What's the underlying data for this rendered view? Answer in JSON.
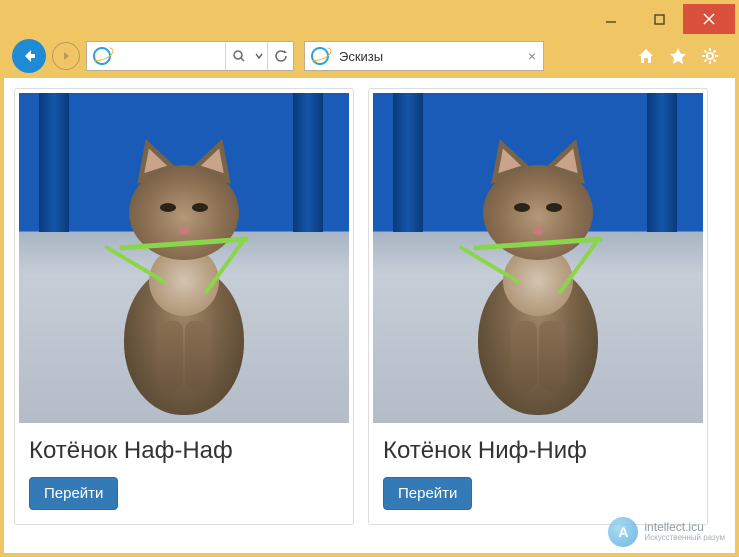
{
  "window": {
    "minimize": "–",
    "maximize": "□",
    "close": "×"
  },
  "toolbar": {
    "address": "",
    "tab_title": "Эскизы",
    "search_placeholder": ""
  },
  "cards": [
    {
      "title": "Котёнок Наф-Наф",
      "button": "Перейти"
    },
    {
      "title": "Котёнок Ниф-Ниф",
      "button": "Перейти"
    }
  ],
  "watermark": {
    "letter": "A",
    "brand": "intellect.icu",
    "subtitle": "Искусственный разум"
  }
}
